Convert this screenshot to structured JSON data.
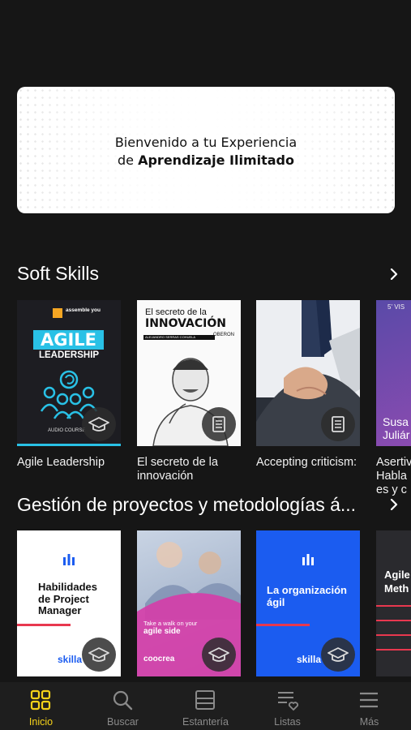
{
  "banner": {
    "line1": "Bienvenido a tu Experiencia",
    "line2_prefix": "de ",
    "line2_bold": "Aprendizaje Ilimitado"
  },
  "sections": [
    {
      "title": "Soft Skills",
      "cards": [
        {
          "title": "Agile Leadership",
          "brand": "assemble you",
          "heading1": "AGILE",
          "heading2": "LEADERSHIP",
          "footer": "AUDIO COURSE",
          "badge": "graduation-cap-icon"
        },
        {
          "title": "El secreto de la innovación",
          "heading1": "El secreto de la",
          "heading2": "INNOVACIÓN",
          "author": "ALEJANDRO SERRAS COHUELA",
          "publisher": "OBERON",
          "badge": "book-icon"
        },
        {
          "title": "Accepting criticism:",
          "badge": "book-icon"
        },
        {
          "title": "Asertividad: Habla es y c",
          "cover_line1": "5' VIS",
          "cover_line2": "Susa",
          "cover_line3": "Juliár"
        }
      ]
    },
    {
      "title": "Gestión de proyectos y metodologías á...",
      "cards": [
        {
          "heading": "Habilidades de Project Manager",
          "brand": "skilla",
          "badge": "graduation-cap-icon"
        },
        {
          "tagline1": "Take a walk on your",
          "tagline2": "agile side",
          "brand": "coocrea",
          "badge": "graduation-cap-icon"
        },
        {
          "heading": "La organización ágil",
          "brand": "skilla",
          "badge": "graduation-cap-icon"
        },
        {
          "heading": "Agile Meth"
        }
      ]
    }
  ],
  "tabs": [
    {
      "label": "Inicio",
      "icon": "grid-icon",
      "active": true
    },
    {
      "label": "Buscar",
      "icon": "search-icon",
      "active": false
    },
    {
      "label": "Estantería",
      "icon": "bookshelf-icon",
      "active": false
    },
    {
      "label": "Listas",
      "icon": "list-heart-icon",
      "active": false
    },
    {
      "label": "Más",
      "icon": "menu-icon",
      "active": false
    }
  ],
  "colors": {
    "background": "#161616",
    "accent": "#f5d21a",
    "tab_inactive": "#8a8a8a",
    "skilla_blue": "#1b5cf0",
    "agile_cyan": "#29c1e6"
  }
}
